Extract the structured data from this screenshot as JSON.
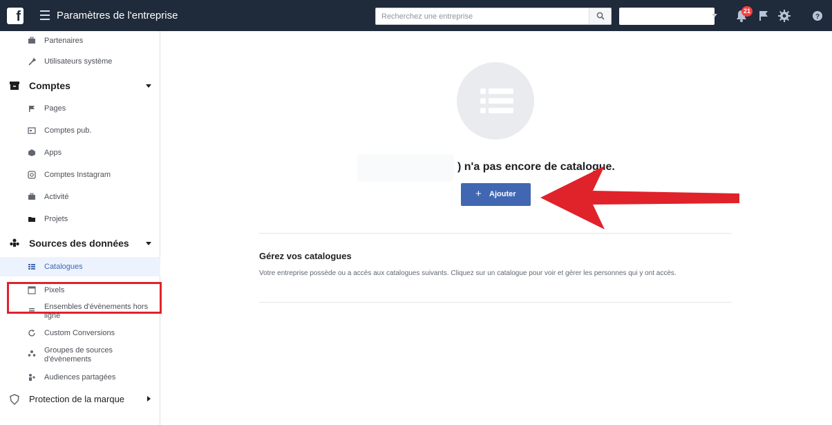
{
  "topbar": {
    "logo": "f",
    "title": "Paramètres de l'entreprise",
    "search_placeholder": "Recherchez une entreprise",
    "notifications_count": "21",
    "icons": [
      "hamburger-icon",
      "search-icon",
      "notifications-icon",
      "flag-icon",
      "settings-icon",
      "help-icon"
    ]
  },
  "sidebar": {
    "top_items": [
      {
        "label": "Partenaires",
        "icon": "briefcase-icon"
      },
      {
        "label": "Utilisateurs système",
        "icon": "wrench-icon"
      }
    ],
    "groups": [
      {
        "label": "Comptes",
        "icon": "archive-icon",
        "items": [
          {
            "label": "Pages",
            "icon": "flag-icon"
          },
          {
            "label": "Comptes pub.",
            "icon": "ad-account-icon"
          },
          {
            "label": "Apps",
            "icon": "cube-icon"
          },
          {
            "label": "Comptes Instagram",
            "icon": "instagram-icon"
          },
          {
            "label": "Activité",
            "icon": "briefcase-icon"
          },
          {
            "label": "Projets",
            "icon": "folder-icon"
          }
        ]
      },
      {
        "label": "Sources des données",
        "icon": "people-icon",
        "items": [
          {
            "label": "Catalogues",
            "icon": "grid-icon",
            "active": true
          },
          {
            "label": "Pixels",
            "icon": "code-icon"
          },
          {
            "label": "Ensembles d'évènements hors ligne",
            "icon": "list-icon"
          },
          {
            "label": "Custom Conversions",
            "icon": "refresh-icon"
          },
          {
            "label": "Groupes de sources d'évènements",
            "icon": "sources-icon"
          },
          {
            "label": "Audiences partagées",
            "icon": "shared-audience-icon"
          }
        ]
      },
      {
        "label": "Protection de la marque",
        "icon": "shield-icon"
      }
    ]
  },
  "main": {
    "empty_message": ") n'a pas encore de catalogue.",
    "add_button": "Ajouter",
    "add_button_icon": "+",
    "manage_title": "Gérez vos catalogues",
    "manage_description": "Votre entreprise possède ou a accès aux catalogues suivants. Cliquez sur un catalogue pour voir et gérer les personnes qui y ont accès."
  },
  "colors": {
    "topbar": "#1f2a3a",
    "primary_button": "#4267b2",
    "annotation_red": "#e0222a",
    "sidebar_active": "#ecf3ff"
  }
}
